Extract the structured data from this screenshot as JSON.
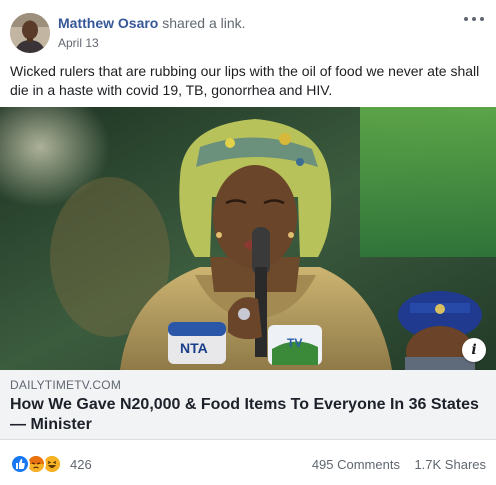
{
  "post": {
    "author": "Matthew Osaro",
    "action": "shared a link.",
    "date": "April 13",
    "message": "Wicked rulers that are rubbing our lips with the oil of food we never ate shall die in a haste with covid 19, TB, gonorrhea and HIV."
  },
  "link": {
    "domain": "DAILYTIMETV.COM",
    "headline": "How We Gave N20,000 & Food Items To Everyone In 36 States — Minister",
    "mic_labels": [
      "NTA",
      "TV"
    ]
  },
  "footer": {
    "reaction_icons": [
      "like-reaction-icon",
      "angry-reaction-icon",
      "haha-reaction-icon"
    ],
    "reaction_count": "426",
    "comments": "495 Comments",
    "shares": "1.7K Shares"
  },
  "colors": {
    "author_link": "#365899",
    "link_box_bg": "#f2f3f5",
    "like_blue": "#1877f2",
    "angry_red": "#e9710f",
    "haha_yellow": "#f7b125"
  }
}
